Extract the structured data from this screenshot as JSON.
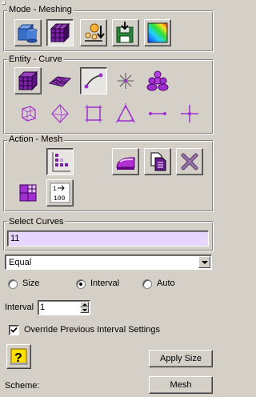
{
  "mode_group": {
    "title": "Mode - Meshing",
    "buttons": [
      {
        "icon": "geometry-volumes-icon",
        "name": "mode-geometry-button"
      },
      {
        "icon": "mesh-cube-icon",
        "name": "mode-mesh-button"
      },
      {
        "icon": "boundary-conditions-icon",
        "name": "mode-bc-button"
      },
      {
        "icon": "save-export-icon",
        "name": "mode-export-button"
      },
      {
        "icon": "analysis-contour-icon",
        "name": "mode-analysis-button"
      }
    ]
  },
  "entity_group": {
    "title": "Entity - Curve",
    "selected": "curve"
  },
  "action_group": {
    "title": "Action - Mesh"
  },
  "select": {
    "label": "Select Curves",
    "value": "11"
  },
  "scheme_combo": {
    "value": "Equal"
  },
  "radios": [
    {
      "label": "Size",
      "selected": false
    },
    {
      "label": "Interval",
      "selected": true
    },
    {
      "label": "Auto",
      "selected": false
    }
  ],
  "interval": {
    "label": "Interval",
    "value": "1"
  },
  "override": {
    "label": "Override Previous Interval Settings",
    "checked": true
  },
  "apply_label": "Apply Size",
  "scheme": {
    "label": "Scheme:",
    "button": "Mesh"
  },
  "colors": {
    "background": "#d4d0c8",
    "accent": "#9a2fbf",
    "input_highlight": "#e6d6ff"
  }
}
